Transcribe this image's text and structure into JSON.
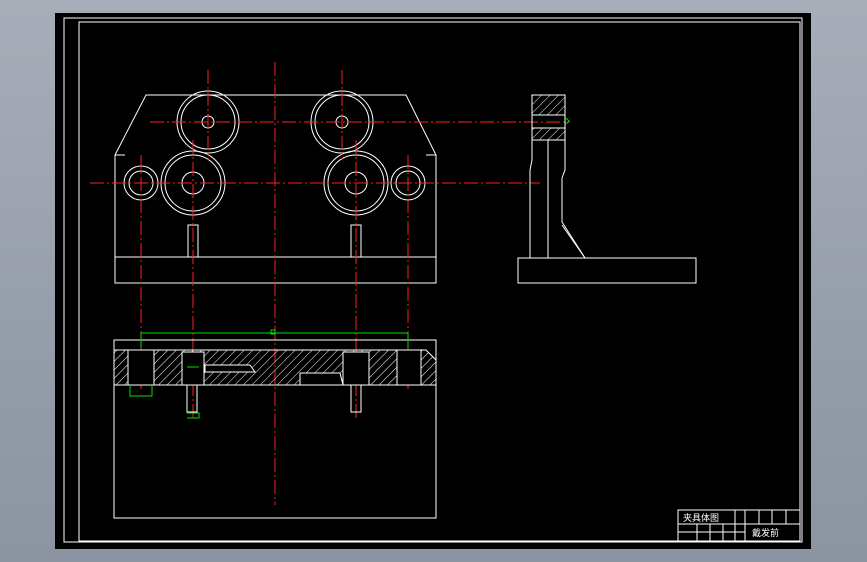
{
  "title_block": {
    "drawing_name": "夹具体图",
    "designer": "戴发前"
  },
  "colors": {
    "background": "#9aa2ae",
    "paper": "#000000",
    "lines": "#ffffff",
    "centerlines": "#ff2020",
    "dimensions": "#00e000"
  }
}
